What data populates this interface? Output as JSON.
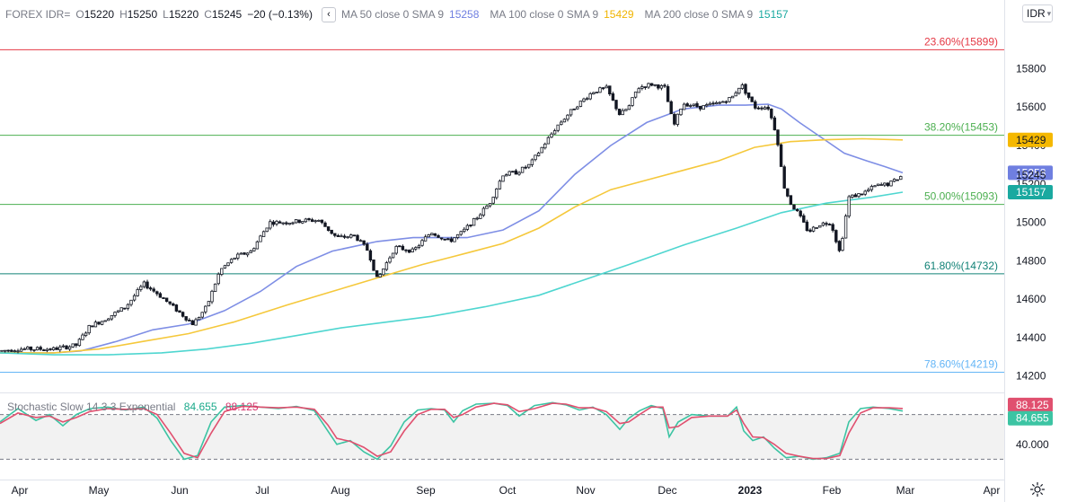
{
  "legend": {
    "symbol": "FOREX IDR=",
    "o_label": "O",
    "o_value": "15220",
    "h_label": "H",
    "h_value": "15250",
    "l_label": "L",
    "l_value": "15220",
    "c_label": "C",
    "c_value": "15245",
    "change": "−20 (−0.13%)",
    "collapse_glyph": "‹",
    "ma50_label": "MA 50 close 0 SMA 9",
    "ma50_value": "15258",
    "ma100_label": "MA 100 close 0 SMA 9",
    "ma100_value": "15429",
    "ma200_label": "MA 200 close 0 SMA 9",
    "ma200_value": "15157"
  },
  "symbol_selector": {
    "label": "IDR"
  },
  "stochastic": {
    "label": "Stochastic Slow 14 3 3 Exponential",
    "k_value": "84.655",
    "d_value": "88.125"
  },
  "colors": {
    "ma50": "#7e8ee5",
    "ma100": "#f5c83b",
    "ma200": "#4fd6d0",
    "fib_red": "#e53945",
    "fib_green": "#4caf50",
    "fib_teal": "#128277",
    "fib_blue": "#64b5f6",
    "stoch_k": "#3cc4a3",
    "stoch_d": "#e0506f"
  },
  "chart_data": {
    "type": "candlestick",
    "x_axis_labels": [
      "Apr",
      "May",
      "Jun",
      "Jul",
      "Aug",
      "Sep",
      "Oct",
      "Nov",
      "Dec",
      "2023",
      "Feb",
      "Mar",
      "Apr"
    ],
    "y_axis_labels": [
      "15800",
      "15600",
      "15400",
      "15200",
      "15000",
      "14800",
      "14600",
      "14400",
      "14200"
    ],
    "ylim": [
      14170,
      15980
    ],
    "fib_levels": [
      {
        "label": "23.60%(15899)",
        "value": 15899,
        "color": "fib_red"
      },
      {
        "label": "38.20%(15453)",
        "value": 15453,
        "color": "fib_green"
      },
      {
        "label": "50.00%(15093)",
        "value": 15093,
        "color": "fib_green"
      },
      {
        "label": "61.80%(14732)",
        "value": 14732,
        "color": "fib_teal"
      },
      {
        "label": "78.60%(14219)",
        "value": 14219,
        "color": "fib_blue"
      }
    ],
    "price_badges": [
      {
        "text": "15429",
        "value": 15429,
        "bg": "#f5b800",
        "fg": "#131722"
      },
      {
        "text": "15258",
        "value": 15258,
        "bg": "#6f7fe0",
        "fg": "#ffffff"
      },
      {
        "text": "15245",
        "value": 15245,
        "bg": "none",
        "fg": "#131722"
      },
      {
        "text": "15157",
        "value": 15157,
        "bg": "#1aa9a0",
        "fg": "#ffffff"
      }
    ],
    "price_anchors": [
      [
        0,
        14330
      ],
      [
        20,
        14340
      ],
      [
        60,
        14340
      ],
      [
        85,
        14360
      ],
      [
        100,
        14460
      ],
      [
        115,
        14490
      ],
      [
        140,
        14560
      ],
      [
        160,
        14680
      ],
      [
        175,
        14630
      ],
      [
        195,
        14550
      ],
      [
        215,
        14470
      ],
      [
        230,
        14560
      ],
      [
        245,
        14750
      ],
      [
        262,
        14820
      ],
      [
        280,
        14850
      ],
      [
        300,
        15000
      ],
      [
        320,
        15000
      ],
      [
        340,
        15010
      ],
      [
        355,
        15010
      ],
      [
        375,
        14920
      ],
      [
        395,
        14930
      ],
      [
        410,
        14850
      ],
      [
        420,
        14700
      ],
      [
        440,
        14870
      ],
      [
        460,
        14850
      ],
      [
        480,
        14950
      ],
      [
        500,
        14900
      ],
      [
        515,
        14950
      ],
      [
        530,
        15020
      ],
      [
        545,
        15100
      ],
      [
        560,
        15250
      ],
      [
        575,
        15260
      ],
      [
        590,
        15300
      ],
      [
        605,
        15400
      ],
      [
        620,
        15500
      ],
      [
        640,
        15600
      ],
      [
        660,
        15680
      ],
      [
        675,
        15700
      ],
      [
        690,
        15560
      ],
      [
        700,
        15600
      ],
      [
        710,
        15700
      ],
      [
        725,
        15720
      ],
      [
        740,
        15700
      ],
      [
        750,
        15500
      ],
      [
        760,
        15620
      ],
      [
        780,
        15600
      ],
      [
        800,
        15620
      ],
      [
        815,
        15650
      ],
      [
        825,
        15720
      ],
      [
        840,
        15600
      ],
      [
        855,
        15600
      ],
      [
        865,
        15450
      ],
      [
        872,
        15200
      ],
      [
        880,
        15100
      ],
      [
        888,
        15050
      ],
      [
        900,
        14950
      ],
      [
        912,
        14990
      ],
      [
        925,
        15000
      ],
      [
        935,
        14840
      ],
      [
        945,
        15130
      ],
      [
        960,
        15150
      ],
      [
        975,
        15190
      ],
      [
        990,
        15200
      ],
      [
        1005,
        15245
      ]
    ],
    "series": [
      {
        "name": "MA 50 close 0 SMA 9",
        "color": "ma50",
        "values": [
          [
            0,
            14320
          ],
          [
            60,
            14320
          ],
          [
            90,
            14330
          ],
          [
            130,
            14380
          ],
          [
            170,
            14440
          ],
          [
            210,
            14470
          ],
          [
            250,
            14540
          ],
          [
            290,
            14640
          ],
          [
            330,
            14770
          ],
          [
            370,
            14850
          ],
          [
            420,
            14900
          ],
          [
            460,
            14920
          ],
          [
            520,
            14920
          ],
          [
            560,
            14960
          ],
          [
            600,
            15060
          ],
          [
            640,
            15250
          ],
          [
            680,
            15400
          ],
          [
            720,
            15520
          ],
          [
            760,
            15590
          ],
          [
            800,
            15610
          ],
          [
            830,
            15610
          ],
          [
            855,
            15615
          ],
          [
            870,
            15590
          ],
          [
            890,
            15520
          ],
          [
            915,
            15440
          ],
          [
            940,
            15360
          ],
          [
            965,
            15320
          ],
          [
            985,
            15290
          ],
          [
            1005,
            15258
          ]
        ]
      },
      {
        "name": "MA 100 close 0 SMA 9",
        "color": "ma100",
        "values": [
          [
            0,
            14320
          ],
          [
            60,
            14320
          ],
          [
            110,
            14340
          ],
          [
            160,
            14380
          ],
          [
            210,
            14420
          ],
          [
            260,
            14480
          ],
          [
            320,
            14570
          ],
          [
            370,
            14640
          ],
          [
            420,
            14710
          ],
          [
            470,
            14780
          ],
          [
            520,
            14840
          ],
          [
            560,
            14890
          ],
          [
            600,
            14970
          ],
          [
            640,
            15080
          ],
          [
            680,
            15170
          ],
          [
            720,
            15220
          ],
          [
            760,
            15270
          ],
          [
            800,
            15320
          ],
          [
            840,
            15390
          ],
          [
            880,
            15420
          ],
          [
            920,
            15430
          ],
          [
            960,
            15435
          ],
          [
            1005,
            15429
          ]
        ]
      },
      {
        "name": "MA 200 close 0 SMA 9",
        "color": "ma200",
        "values": [
          [
            0,
            14320
          ],
          [
            60,
            14310
          ],
          [
            120,
            14310
          ],
          [
            180,
            14320
          ],
          [
            230,
            14340
          ],
          [
            280,
            14370
          ],
          [
            330,
            14410
          ],
          [
            380,
            14450
          ],
          [
            430,
            14480
          ],
          [
            480,
            14510
          ],
          [
            540,
            14560
          ],
          [
            600,
            14620
          ],
          [
            650,
            14700
          ],
          [
            700,
            14780
          ],
          [
            760,
            14880
          ],
          [
            820,
            14970
          ],
          [
            870,
            15050
          ],
          [
            920,
            15100
          ],
          [
            970,
            15130
          ],
          [
            1005,
            15157
          ]
        ]
      }
    ],
    "stochastic": {
      "ylim": [
        0,
        100
      ],
      "levels": [
        80,
        20
      ],
      "y_axis_labels": [
        "40.000"
      ],
      "badges": [
        {
          "text": "88.125",
          "value": 88.125,
          "bg": "#e0506f"
        },
        {
          "text": "84.655",
          "value": 84.655,
          "bg": "#3cc4a3"
        }
      ],
      "k_values": [
        [
          0,
          70
        ],
        [
          20,
          88
        ],
        [
          40,
          72
        ],
        [
          55,
          80
        ],
        [
          70,
          65
        ],
        [
          85,
          80
        ],
        [
          100,
          88
        ],
        [
          120,
          90
        ],
        [
          140,
          86
        ],
        [
          160,
          90
        ],
        [
          175,
          75
        ],
        [
          190,
          45
        ],
        [
          205,
          20
        ],
        [
          220,
          25
        ],
        [
          235,
          70
        ],
        [
          250,
          90
        ],
        [
          270,
          92
        ],
        [
          290,
          90
        ],
        [
          310,
          88
        ],
        [
          330,
          91
        ],
        [
          350,
          85
        ],
        [
          365,
          58
        ],
        [
          375,
          40
        ],
        [
          390,
          45
        ],
        [
          405,
          30
        ],
        [
          420,
          20
        ],
        [
          435,
          38
        ],
        [
          450,
          70
        ],
        [
          465,
          86
        ],
        [
          480,
          88
        ],
        [
          495,
          86
        ],
        [
          505,
          70
        ],
        [
          515,
          85
        ],
        [
          530,
          94
        ],
        [
          550,
          95
        ],
        [
          565,
          92
        ],
        [
          578,
          78
        ],
        [
          595,
          92
        ],
        [
          615,
          96
        ],
        [
          630,
          93
        ],
        [
          645,
          86
        ],
        [
          660,
          90
        ],
        [
          675,
          80
        ],
        [
          690,
          60
        ],
        [
          700,
          75
        ],
        [
          712,
          85
        ],
        [
          725,
          92
        ],
        [
          738,
          88
        ],
        [
          745,
          50
        ],
        [
          755,
          70
        ],
        [
          770,
          80
        ],
        [
          790,
          78
        ],
        [
          810,
          78
        ],
        [
          820,
          90
        ],
        [
          828,
          58
        ],
        [
          838,
          45
        ],
        [
          850,
          50
        ],
        [
          862,
          35
        ],
        [
          875,
          22
        ],
        [
          890,
          24
        ],
        [
          905,
          20
        ],
        [
          920,
          22
        ],
        [
          935,
          28
        ],
        [
          945,
          70
        ],
        [
          958,
          88
        ],
        [
          972,
          90
        ],
        [
          990,
          88
        ],
        [
          1005,
          84.655
        ]
      ],
      "d_values": [
        [
          0,
          68
        ],
        [
          20,
          82
        ],
        [
          40,
          76
        ],
        [
          55,
          78
        ],
        [
          70,
          70
        ],
        [
          85,
          76
        ],
        [
          100,
          84
        ],
        [
          120,
          88
        ],
        [
          140,
          87
        ],
        [
          160,
          88
        ],
        [
          175,
          80
        ],
        [
          190,
          55
        ],
        [
          205,
          28
        ],
        [
          220,
          22
        ],
        [
          235,
          55
        ],
        [
          250,
          84
        ],
        [
          270,
          91
        ],
        [
          290,
          90
        ],
        [
          310,
          89
        ],
        [
          330,
          90
        ],
        [
          350,
          87
        ],
        [
          365,
          66
        ],
        [
          375,
          48
        ],
        [
          390,
          44
        ],
        [
          405,
          36
        ],
        [
          420,
          24
        ],
        [
          435,
          30
        ],
        [
          450,
          58
        ],
        [
          465,
          80
        ],
        [
          480,
          87
        ],
        [
          495,
          87
        ],
        [
          505,
          76
        ],
        [
          515,
          80
        ],
        [
          530,
          90
        ],
        [
          550,
          95
        ],
        [
          565,
          93
        ],
        [
          578,
          84
        ],
        [
          595,
          88
        ],
        [
          615,
          95
        ],
        [
          630,
          94
        ],
        [
          645,
          89
        ],
        [
          660,
          89
        ],
        [
          675,
          84
        ],
        [
          690,
          68
        ],
        [
          700,
          70
        ],
        [
          712,
          80
        ],
        [
          725,
          90
        ],
        [
          738,
          90
        ],
        [
          745,
          62
        ],
        [
          755,
          64
        ],
        [
          770,
          76
        ],
        [
          790,
          78
        ],
        [
          810,
          78
        ],
        [
          820,
          86
        ],
        [
          828,
          68
        ],
        [
          838,
          50
        ],
        [
          850,
          49
        ],
        [
          862,
          40
        ],
        [
          875,
          28
        ],
        [
          890,
          24
        ],
        [
          905,
          21
        ],
        [
          920,
          21
        ],
        [
          935,
          25
        ],
        [
          945,
          55
        ],
        [
          958,
          82
        ],
        [
          972,
          89
        ],
        [
          990,
          89
        ],
        [
          1005,
          88.125
        ]
      ]
    }
  }
}
